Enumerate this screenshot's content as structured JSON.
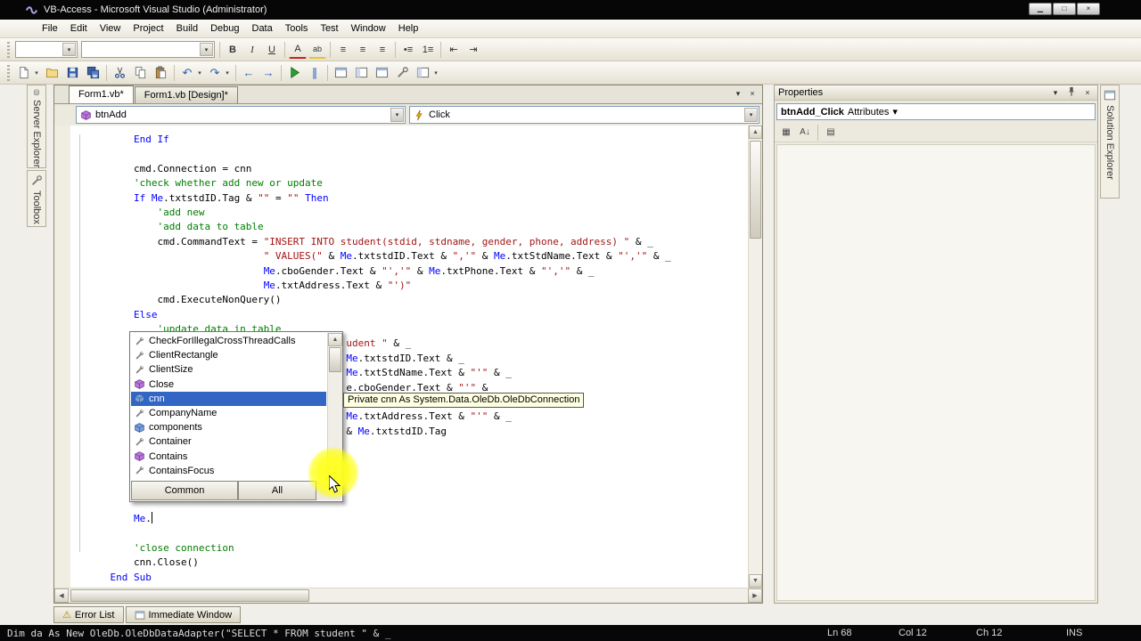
{
  "window": {
    "title": "VB-Access - Microsoft Visual Studio (Administrator)"
  },
  "icons": {
    "chevron_down": "▾",
    "close": "×",
    "minimize": "▁",
    "maximize": "□",
    "scroll_up": "▲",
    "scroll_down": "▼",
    "scroll_left": "◀",
    "scroll_right": "▶"
  },
  "menu_bar": {
    "items": [
      "File",
      "Edit",
      "View",
      "Project",
      "Build",
      "Debug",
      "Data",
      "Tools",
      "Test",
      "Window",
      "Help"
    ]
  },
  "toolbar_format": {
    "buttons": [
      {
        "t": "grip"
      },
      {
        "t": "combo",
        "name": "style-combo",
        "w": 70
      },
      {
        "t": "combo",
        "name": "font-combo",
        "w": 150
      },
      {
        "t": "sep"
      },
      {
        "t": "btn",
        "name": "bold-button",
        "g": "B",
        "cls": "g-bold"
      },
      {
        "t": "btn",
        "name": "italic-button",
        "g": "I",
        "cls": "g-italic"
      },
      {
        "t": "btn",
        "name": "underline-button",
        "g": "U",
        "cls": "g-underline"
      },
      {
        "t": "sep"
      },
      {
        "t": "btn",
        "name": "text-color-button",
        "g": "A",
        "cls": "g-red"
      },
      {
        "t": "btn",
        "name": "highlight-button",
        "g": "ab",
        "cls": "g-hl"
      },
      {
        "t": "sep"
      },
      {
        "t": "btn",
        "name": "align-left-button",
        "g": "≡"
      },
      {
        "t": "btn",
        "name": "align-center-button",
        "g": "≡"
      },
      {
        "t": "btn",
        "name": "align-right-button",
        "g": "≡"
      },
      {
        "t": "sep"
      },
      {
        "t": "btn",
        "name": "bullet-list-button",
        "g": "•≡"
      },
      {
        "t": "btn",
        "name": "numbered-list-button",
        "g": "1≡"
      },
      {
        "t": "sep"
      },
      {
        "t": "btn",
        "name": "decrease-indent-button",
        "g": "⇤"
      },
      {
        "t": "btn",
        "name": "increase-indent-button",
        "g": "⇥"
      }
    ]
  },
  "toolbar_standard": {
    "buttons": [
      {
        "t": "grip"
      },
      {
        "t": "svg",
        "name": "new-project-button",
        "id": "i-page"
      },
      {
        "t": "btn",
        "name": "new-item-dropdown",
        "g": "▾",
        "cls": "dd"
      },
      {
        "t": "svg",
        "name": "open-file-button",
        "id": "i-folder"
      },
      {
        "t": "svg",
        "name": "save-button",
        "id": "i-disk"
      },
      {
        "t": "svg",
        "name": "save-all-button",
        "id": "i-disks"
      },
      {
        "t": "sep"
      },
      {
        "t": "svg",
        "name": "cut-button",
        "id": "i-cut"
      },
      {
        "t": "svg",
        "name": "copy-button",
        "id": "i-copy"
      },
      {
        "t": "svg",
        "name": "paste-button",
        "id": "i-paste"
      },
      {
        "t": "sep"
      },
      {
        "t": "btn",
        "name": "undo-button",
        "g": "↶",
        "cls": "g-blue"
      },
      {
        "t": "btn",
        "name": "undo-dropdown",
        "g": "▾",
        "cls": "dd"
      },
      {
        "t": "btn",
        "name": "redo-button",
        "g": "↷",
        "cls": "g-blue"
      },
      {
        "t": "btn",
        "name": "redo-dropdown",
        "g": "▾",
        "cls": "dd"
      },
      {
        "t": "sep"
      },
      {
        "t": "btn",
        "name": "navigate-backward-button",
        "g": "←",
        "cls": "g-blue"
      },
      {
        "t": "btn",
        "name": "navigate-forward-button",
        "g": "→",
        "cls": "g-blue"
      },
      {
        "t": "sep"
      },
      {
        "t": "svg",
        "name": "start-debugging-button",
        "id": "i-play"
      },
      {
        "t": "btn",
        "name": "break-all-button",
        "g": "∥",
        "cls": "g-blue"
      },
      {
        "t": "sep"
      },
      {
        "t": "svg",
        "name": "solution-explorer-button",
        "id": "i-win"
      },
      {
        "t": "svg",
        "name": "properties-window-button",
        "id": "i-win2"
      },
      {
        "t": "svg",
        "name": "object-browser-button",
        "id": "i-win"
      },
      {
        "t": "svg",
        "name": "toolbox-button",
        "id": "i-tools"
      },
      {
        "t": "svg",
        "name": "error-list-button",
        "id": "i-win2"
      },
      {
        "t": "btn",
        "name": "toolbar-options-button",
        "g": "▾",
        "cls": "dd"
      }
    ]
  },
  "side_tabs_left": [
    {
      "label": "Server Explorer",
      "icon": "server"
    },
    {
      "label": "Toolbox",
      "icon": "toolbox"
    }
  ],
  "side_tabs_right": [
    {
      "label": "Solution Explorer",
      "icon": "solution"
    }
  ],
  "document_tabs": [
    {
      "label": "Form1.vb*",
      "active": true
    },
    {
      "label": "Form1.vb [Design]*",
      "active": false
    }
  ],
  "nav_bar": {
    "object_dropdown": "btnAdd",
    "event_dropdown": "Click"
  },
  "code_editor": {
    "lines": [
      {
        "s": [
          [
            "        ",
            ""
          ],
          [
            "End If",
            "kw"
          ]
        ]
      },
      {
        "s": []
      },
      {
        "s": [
          [
            "        cmd.Connection = cnn",
            ""
          ]
        ]
      },
      {
        "s": [
          [
            "        'check whether add new or update",
            "cm"
          ]
        ]
      },
      {
        "s": [
          [
            "        ",
            ""
          ],
          [
            "If",
            "kw"
          ],
          [
            " ",
            ""
          ],
          [
            "Me",
            "kw"
          ],
          [
            ".txtstdID.Tag & ",
            ""
          ],
          [
            "\"\"",
            "str"
          ],
          [
            " = ",
            ""
          ],
          [
            "\"\"",
            "str"
          ],
          [
            " ",
            ""
          ],
          [
            "Then",
            "kw"
          ]
        ]
      },
      {
        "s": [
          [
            "            'add new",
            "cm"
          ]
        ]
      },
      {
        "s": [
          [
            "            'add data to table",
            "cm"
          ]
        ]
      },
      {
        "s": [
          [
            "            cmd.CommandText = ",
            ""
          ],
          [
            "\"INSERT INTO student(stdid, stdname, gender, phone, address) \"",
            "str"
          ],
          [
            " & _",
            ""
          ]
        ]
      },
      {
        "s": [
          [
            "                              ",
            ""
          ],
          [
            "\" VALUES(\"",
            "str"
          ],
          [
            " & ",
            ""
          ],
          [
            "Me",
            "kw"
          ],
          [
            ".txtstdID.Text & ",
            ""
          ],
          [
            "\",'\"",
            "str"
          ],
          [
            " & ",
            ""
          ],
          [
            "Me",
            "kw"
          ],
          [
            ".txtStdName.Text & ",
            ""
          ],
          [
            "\"','\"",
            "str"
          ],
          [
            " & _",
            ""
          ]
        ]
      },
      {
        "s": [
          [
            "                              ",
            ""
          ],
          [
            "Me",
            "kw"
          ],
          [
            ".cboGender.Text & ",
            ""
          ],
          [
            "\"','\"",
            "str"
          ],
          [
            " & ",
            ""
          ],
          [
            "Me",
            "kw"
          ],
          [
            ".txtPhone.Text & ",
            ""
          ],
          [
            "\"','\"",
            "str"
          ],
          [
            " & _",
            ""
          ]
        ]
      },
      {
        "s": [
          [
            "                              ",
            ""
          ],
          [
            "Me",
            "kw"
          ],
          [
            ".txtAddress.Text & ",
            ""
          ],
          [
            "\"')\"",
            "str"
          ]
        ]
      },
      {
        "s": [
          [
            "            cmd.ExecuteNonQuery()",
            ""
          ]
        ]
      },
      {
        "s": [
          [
            "        ",
            ""
          ],
          [
            "Else",
            "kw"
          ]
        ]
      },
      {
        "s": [
          [
            "            'update data in table",
            "cm"
          ]
        ]
      },
      {
        "s": [
          [
            "                                            ",
            ""
          ],
          [
            "udent \"",
            "str"
          ],
          [
            " & _",
            ""
          ]
        ]
      },
      {
        "s": [
          [
            "                                            ",
            ""
          ],
          [
            "Me",
            "kw"
          ],
          [
            ".txtstdID.Text & _",
            ""
          ]
        ]
      },
      {
        "s": [
          [
            "                                            ",
            ""
          ],
          [
            "Me",
            "kw"
          ],
          [
            ".txtStdName.Text & ",
            ""
          ],
          [
            "\"'\"",
            "str"
          ],
          [
            " & _",
            ""
          ]
        ]
      },
      {
        "s": [
          [
            "                                            ",
            ""
          ],
          [
            "e.cboGender.Text & ",
            ""
          ],
          [
            "\"'\"",
            "str"
          ],
          [
            " & _",
            ""
          ]
        ]
      },
      {
        "s": []
      },
      {
        "s": [
          [
            "                                            ",
            ""
          ],
          [
            "Me",
            "kw"
          ],
          [
            ".txtAddress.Text & ",
            ""
          ],
          [
            "\"'\"",
            "str"
          ],
          [
            " & _",
            ""
          ]
        ]
      },
      {
        "s": [
          [
            "                                            ",
            ""
          ],
          [
            "& ",
            ""
          ],
          [
            "Me",
            "kw"
          ],
          [
            ".txtstdID.Tag",
            ""
          ]
        ]
      },
      {
        "s": []
      },
      {
        "s": []
      },
      {
        "s": []
      },
      {
        "s": []
      },
      {
        "s": []
      },
      {
        "s": [
          [
            "        ",
            ""
          ],
          [
            "Me",
            "kw"
          ],
          [
            ".",
            ""
          ]
        ],
        "caret": true
      },
      {
        "s": []
      },
      {
        "s": [
          [
            "        'close connection",
            "cm"
          ]
        ]
      },
      {
        "s": [
          [
            "        cnn.Close()",
            ""
          ]
        ]
      },
      {
        "s": [
          [
            "    ",
            ""
          ],
          [
            "End Sub",
            "kw"
          ]
        ]
      }
    ]
  },
  "intellisense": {
    "items": [
      {
        "label": "CheckForIllegalCrossThreadCalls",
        "kind": "property"
      },
      {
        "label": "ClientRectangle",
        "kind": "property"
      },
      {
        "label": "ClientSize",
        "kind": "property"
      },
      {
        "label": "Close",
        "kind": "method"
      },
      {
        "label": "cnn",
        "kind": "field"
      },
      {
        "label": "CompanyName",
        "kind": "property"
      },
      {
        "label": "components",
        "kind": "field"
      },
      {
        "label": "Container",
        "kind": "property"
      },
      {
        "label": "Contains",
        "kind": "method"
      },
      {
        "label": "ContainsFocus",
        "kind": "property"
      }
    ],
    "selected_index": 4,
    "footer_tabs": [
      "Common",
      "All"
    ]
  },
  "tooltip": {
    "text": "Private cnn As System.Data.OleDb.OleDbConnection"
  },
  "properties_panel": {
    "title": "Properties",
    "object_name": "btnAdd_Click",
    "object_suffix": "Attributes",
    "toolbar": [
      {
        "t": "btn",
        "name": "categorized-button",
        "g": "▦"
      },
      {
        "t": "btn",
        "name": "alphabetical-button",
        "g": "A↓"
      },
      {
        "t": "sep"
      },
      {
        "t": "btn",
        "name": "property-pages-button",
        "g": "▤"
      }
    ]
  },
  "bottom_panel_tabs": [
    {
      "label": "Error List",
      "icon": "warning"
    },
    {
      "label": "Immediate Window",
      "icon": "window"
    }
  ],
  "status_bar": {
    "message": "Dim da As New OleDb.OleDbDataAdapter(\"SELECT * FROM student \" & _",
    "line": "Ln 68",
    "column": "Col 12",
    "character": "Ch 12",
    "mode": "INS"
  }
}
